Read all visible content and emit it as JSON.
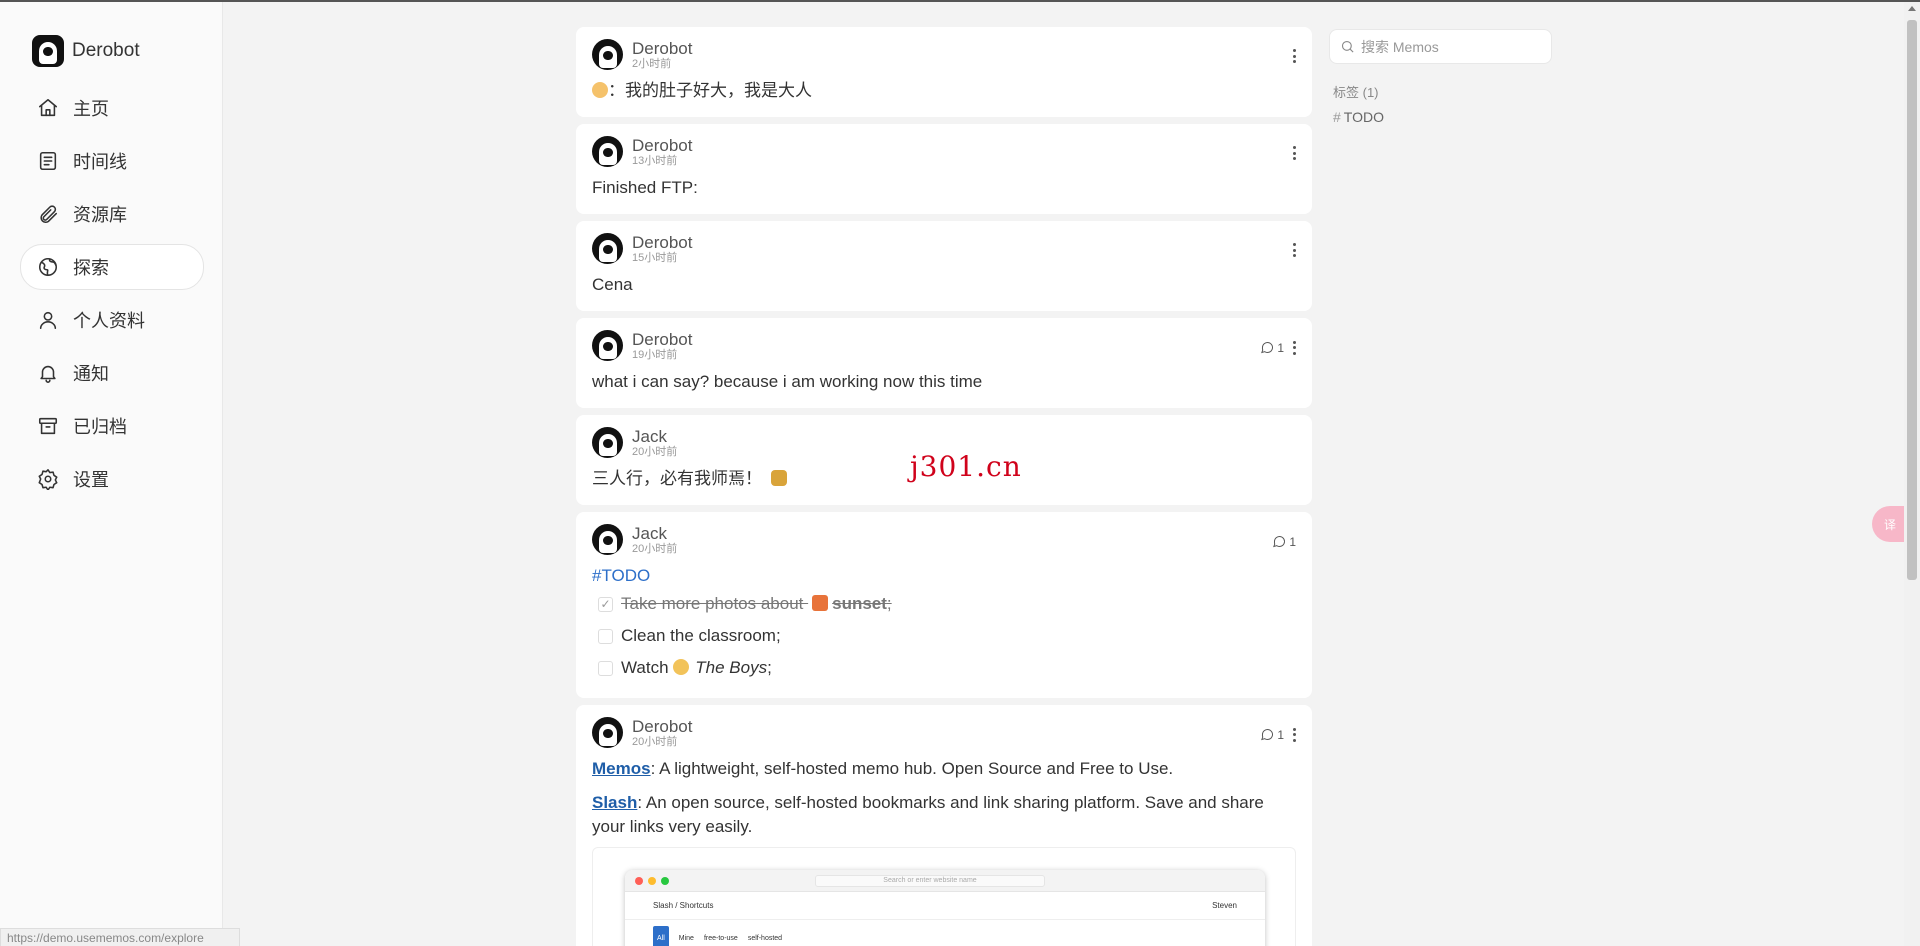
{
  "brand": {
    "name": "Derobot"
  },
  "nav": [
    {
      "label": "主页",
      "icon": "home-icon"
    },
    {
      "label": "时间线",
      "icon": "timeline-icon"
    },
    {
      "label": "资源库",
      "icon": "paperclip-icon"
    },
    {
      "label": "探索",
      "icon": "globe-icon",
      "active": true
    },
    {
      "label": "个人资料",
      "icon": "user-icon"
    },
    {
      "label": "通知",
      "icon": "bell-icon"
    },
    {
      "label": "已归档",
      "icon": "archive-icon"
    },
    {
      "label": "设置",
      "icon": "gear-icon"
    }
  ],
  "status_url": "https://demo.usememos.com/explore",
  "memos": [
    {
      "author": "Derobot",
      "time": "2小时前",
      "text": "：我的肚子好大，我是大人"
    },
    {
      "author": "Derobot",
      "time": "13小时前",
      "text": "Finished FTP:"
    },
    {
      "author": "Derobot",
      "time": "15小时前",
      "text": "Cena"
    },
    {
      "author": "Derobot",
      "time": "19小时前",
      "comments": "1",
      "text": "what i can say? because i am working now this time"
    },
    {
      "author": "Jack",
      "time": "20小时前",
      "text": "三人行，必有我师焉！"
    },
    {
      "author": "Jack",
      "time": "20小时前",
      "comments": "1",
      "tag": "#TODO",
      "todos": [
        {
          "prefix": "Take more photos about ",
          "bold": "sunset",
          "suffix": ";",
          "done": true
        },
        {
          "prefix": "Clean the classroom;",
          "done": false
        },
        {
          "prefix": "Watch ",
          "italic": "The Boys",
          "suffix": ";",
          "done": false
        }
      ]
    },
    {
      "author": "Derobot",
      "time": "20小时前",
      "comments": "1",
      "p1_link": "Memos",
      "p1_text": ": A lightweight, self-hosted memo hub. Open Source and Free to Use.",
      "p2_link": "Slash",
      "p2_text": ": An open source, self-hosted bookmarks and link sharing platform. Save and share your links very easily.",
      "preview": {
        "url": "Search or enter website name",
        "app": "Slash / Shortcuts",
        "user": "Steven",
        "filters": [
          "All",
          "Mine",
          "free-to-use",
          "self-hosted"
        ]
      }
    }
  ],
  "search": {
    "placeholder": "搜索 Memos"
  },
  "tags": {
    "title": "标签 (1)",
    "items": [
      {
        "name": "TODO"
      }
    ]
  },
  "watermark": "j301.cn",
  "colors": {
    "tag": "#2d6fc9",
    "link": "#1f5ea8",
    "watermark": "#d0021b"
  }
}
